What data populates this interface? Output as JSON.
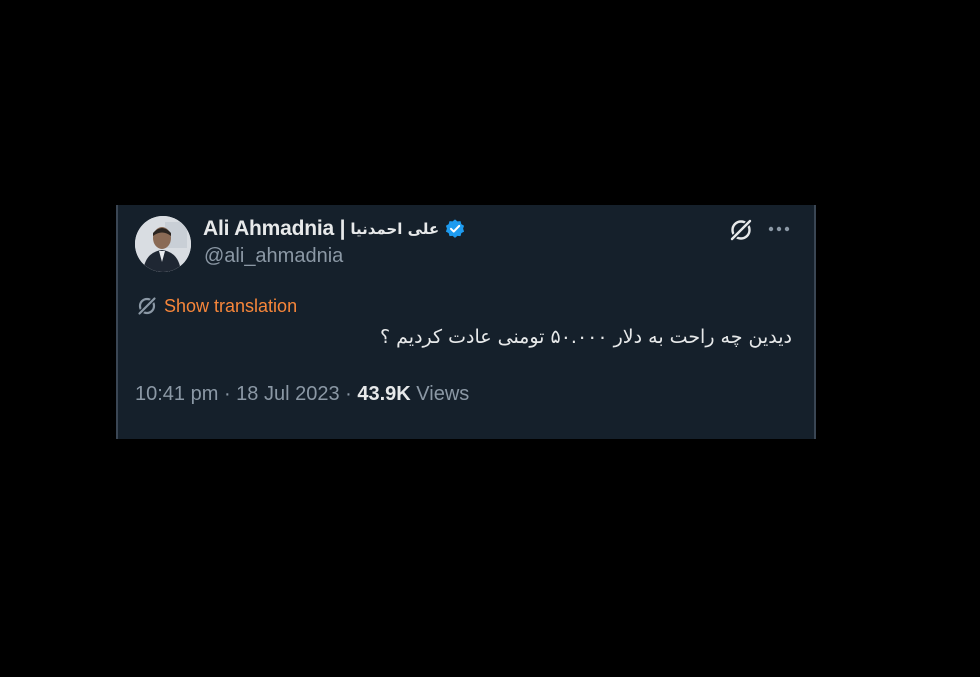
{
  "tweet": {
    "display_name": "Ali Ahmadnia |",
    "display_name_fa": "علی احمدنیا",
    "handle": "@ali_ahmadnia",
    "show_translation_label": "Show translation",
    "text": "دیدین چه راحت به دلار ۵۰.۰۰۰ تومنی عادت کردیم ؟",
    "time": "10:41 pm",
    "separator_1": " · ",
    "date": "18 Jul 2023",
    "separator_2": " · ",
    "views_count": "43.9K",
    "views_label": " Views"
  },
  "colors": {
    "page_background": "#000000",
    "card_background": "#15202b",
    "primary_text": "#e7e9ea",
    "secondary_text": "#8b98a5",
    "translation_accent": "#f7863a",
    "verified_badge": "#1d9bf0"
  },
  "icons": {
    "verified": "verified-badge-icon",
    "grok": "grok-icon",
    "more": "more-options-icon",
    "translate": "translate-icon"
  }
}
